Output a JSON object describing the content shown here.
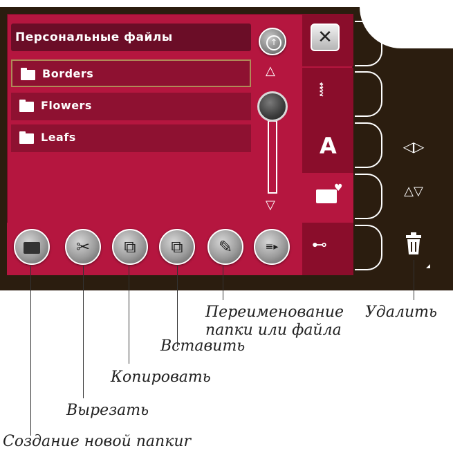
{
  "title": "Персональные файлы",
  "folders": [
    {
      "label": "Borders",
      "selected": true
    },
    {
      "label": "Flowers",
      "selected": false
    },
    {
      "label": "Leafs",
      "selected": false
    }
  ],
  "tabs": [
    {
      "icon": "close-icon",
      "glyph": "✕"
    },
    {
      "icon": "stitch-icon",
      "glyph": "⸾"
    },
    {
      "icon": "font-icon",
      "glyph": "A"
    },
    {
      "icon": "folder-heart-icon",
      "glyph": ""
    },
    {
      "icon": "usb-icon",
      "glyph": "•⊸"
    }
  ],
  "toolbar": [
    {
      "icon": "new-folder-icon",
      "glyph": "🗀"
    },
    {
      "icon": "scissors-icon",
      "glyph": "✂"
    },
    {
      "icon": "copy-icon",
      "glyph": "⧉"
    },
    {
      "icon": "paste-icon",
      "glyph": "⧉"
    },
    {
      "icon": "pencil-icon",
      "glyph": "✎"
    },
    {
      "icon": "view-toggle-icon",
      "glyph": "≡▸"
    }
  ],
  "side_buttons": [
    {
      "icon": "mirror-horizontal-icon",
      "glyph": "◁▷"
    },
    {
      "icon": "mirror-vertical-icon",
      "glyph": "△▽"
    },
    {
      "icon": "trash-icon",
      "glyph": "🗑"
    }
  ],
  "callouts": {
    "delete": "Удалить",
    "rename": "Переименование\nпапки или файла",
    "paste": "Вставить",
    "copy": "Копировать",
    "cut": "Вырезать",
    "new_folder": "Создание новой папкиr"
  },
  "colors": {
    "screen": "#b5163f",
    "title_bar": "#6b0d27",
    "list_item": "#8e1131",
    "machine_body": "#2b1d0f"
  }
}
